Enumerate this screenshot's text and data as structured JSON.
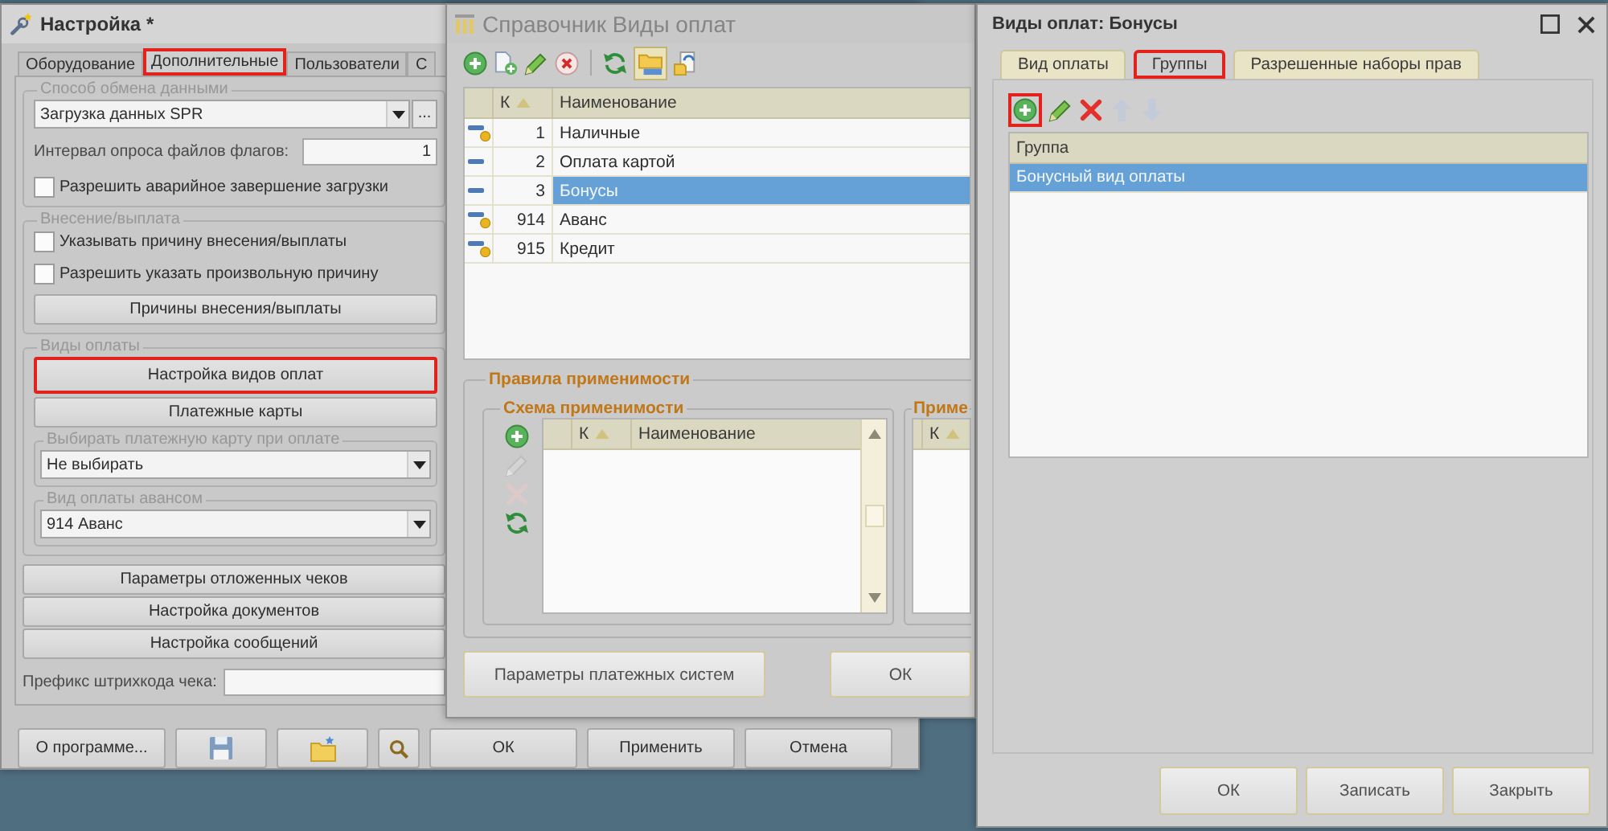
{
  "settings_window": {
    "title": "Настройка *",
    "tabs": [
      {
        "label": "Оборудование",
        "selected": false,
        "highlighted": false
      },
      {
        "label": "Дополнительные",
        "selected": true,
        "highlighted": true
      },
      {
        "label": "Пользователи",
        "selected": false,
        "highlighted": false
      },
      {
        "label": "С",
        "selected": false,
        "highlighted": false
      }
    ],
    "exchange": {
      "title": "Способ обмена данными",
      "method": "Загрузка данных SPR",
      "select_button": "...",
      "interval_label": "Интервал опроса файлов флагов:",
      "interval_value": "1",
      "checkbox": {
        "label": "Разрешить аварийное завершение загрузки",
        "checked": false
      }
    },
    "cash": {
      "title": "Внесение/выплата",
      "checkboxes": [
        {
          "label": "Указывать причину внесения/выплаты",
          "checked": false
        },
        {
          "label": "Разрешить указать произвольную причину",
          "checked": false
        }
      ],
      "button": "Причины внесения/выплаты"
    },
    "payments": {
      "title": "Виды оплаты",
      "buttons": [
        {
          "label": "Настройка видов оплат",
          "highlighted": true
        },
        {
          "label": "Платежные карты",
          "highlighted": false
        }
      ],
      "selects": [
        {
          "title": "Выбирать платежную карту при оплате",
          "value": "Не выбирать"
        },
        {
          "title": "Вид оплаты авансом",
          "value": "914 Аванс"
        }
      ]
    },
    "buttons": [
      "Параметры отложенных чеков",
      "Настройка документов",
      "Настройка сообщений"
    ],
    "barcode_prefix": {
      "label": "Префикс штрихкода чека:"
    },
    "footer": [
      {
        "kind": "text",
        "label": "О программе..."
      },
      {
        "kind": "save"
      },
      {
        "kind": "folder"
      },
      {
        "kind": "search"
      },
      {
        "kind": "text",
        "label": "ОК"
      },
      {
        "kind": "text",
        "label": "Применить"
      },
      {
        "kind": "text",
        "label": "Отмена"
      }
    ]
  },
  "catalog_window": {
    "title": "Справочник Виды оплат",
    "toolbar": [
      [
        {
          "kind": "add",
          "pressed": false
        },
        {
          "kind": "copy",
          "pressed": false
        },
        {
          "kind": "edit",
          "pressed": false
        },
        {
          "kind": "delete",
          "pressed": false
        }
      ],
      [
        {
          "kind": "refresh",
          "pressed": false
        },
        {
          "kind": "hierarchy",
          "pressed": true
        },
        {
          "kind": "lookup",
          "pressed": false
        }
      ]
    ],
    "table": {
      "columns": [
        {
          "label": "К",
          "sorted": true
        },
        {
          "label": "Наименование",
          "sorted": false
        }
      ],
      "rows": [
        {
          "code": "1",
          "name": "Наличные",
          "predefined": true,
          "selected": false
        },
        {
          "code": "2",
          "name": "Оплата картой",
          "predefined": false,
          "selected": false
        },
        {
          "code": "3",
          "name": "Бонусы",
          "predefined": false,
          "selected": true
        },
        {
          "code": "914",
          "name": "Аванс",
          "predefined": true,
          "selected": false
        },
        {
          "code": "915",
          "name": "Кредит",
          "predefined": true,
          "selected": false
        }
      ]
    },
    "rules": {
      "title": "Правила применимости",
      "panels": [
        {
          "title": "Схема применимости",
          "tools": [
            {
              "kind": "add",
              "disabled": false
            },
            {
              "kind": "edit",
              "disabled": true
            },
            {
              "kind": "remove",
              "disabled": true
            },
            {
              "kind": "refresh",
              "disabled": false
            }
          ],
          "columns": [
            {
              "label": "К",
              "sorted": true
            },
            {
              "label": "Наименование",
              "sorted": false
            }
          ]
        },
        {
          "title": "Приме",
          "columns": [
            {
              "label": "К",
              "sorted": true
            }
          ]
        }
      ]
    },
    "buttons": [
      "Параметры платежных систем",
      "ОК"
    ]
  },
  "payment_window": {
    "title": "Виды оплат: Бонусы",
    "tabs": [
      {
        "label": "Вид оплаты",
        "selected": false,
        "highlighted": false
      },
      {
        "label": "Группы",
        "selected": true,
        "highlighted": true
      },
      {
        "label": "Разрешенные наборы прав",
        "selected": false,
        "highlighted": false
      }
    ],
    "toolbar": [
      {
        "kind": "add",
        "disabled": false,
        "highlighted": true
      },
      {
        "kind": "edit",
        "disabled": false,
        "highlighted": false
      },
      {
        "kind": "remove",
        "disabled": false,
        "highlighted": false
      },
      {
        "kind": "up",
        "disabled": true,
        "highlighted": false
      },
      {
        "kind": "down",
        "disabled": true,
        "highlighted": false
      }
    ],
    "table": {
      "columns": [
        "Группа"
      ],
      "rows": [
        {
          "name": "Бонусный вид оплаты",
          "selected": true
        }
      ]
    },
    "buttons": [
      "ОК",
      "Записать",
      "Закрыть"
    ]
  }
}
